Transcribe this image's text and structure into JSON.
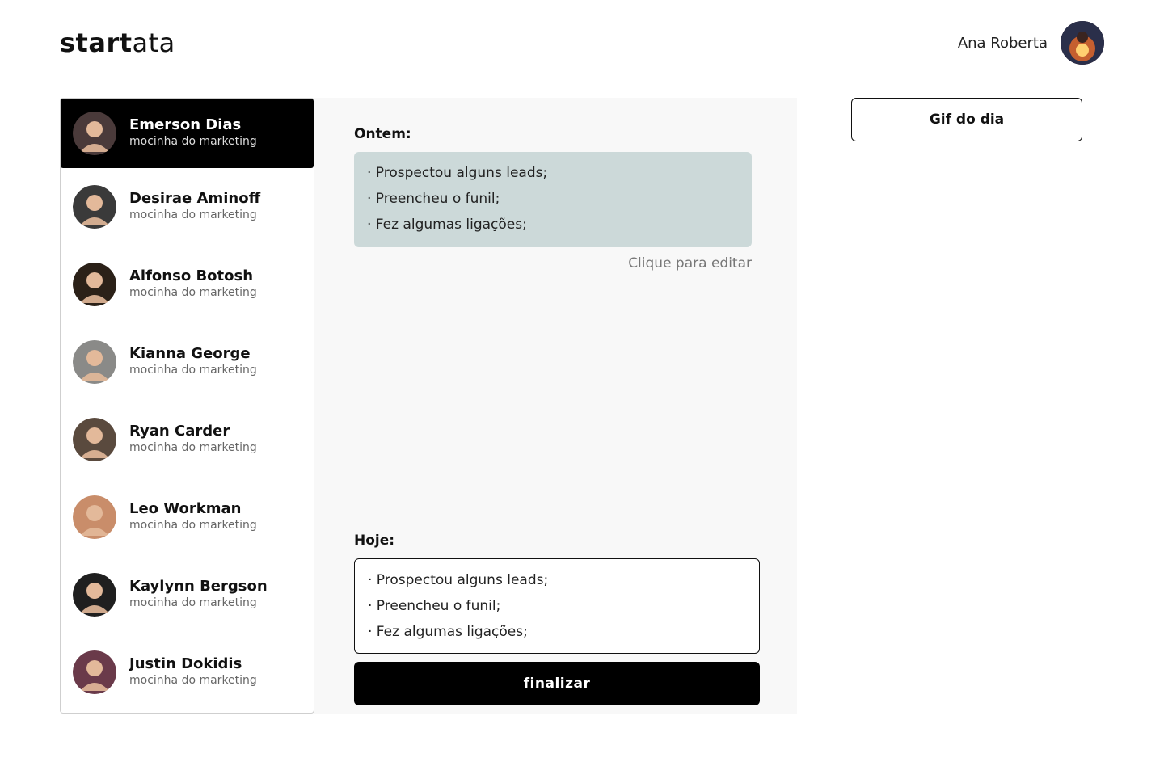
{
  "header": {
    "logo_bold": "start",
    "logo_light": "ata",
    "user_name": "Ana Roberta"
  },
  "sidebar": {
    "people": [
      {
        "name": "Emerson Dias",
        "role": "mocinha do marketing",
        "active": true,
        "avatar_color": "#4a3a3a"
      },
      {
        "name": "Desirae Aminoff",
        "role": "mocinha do marketing",
        "active": false,
        "avatar_color": "#3a3a3a"
      },
      {
        "name": "Alfonso Botosh",
        "role": "mocinha do marketing",
        "active": false,
        "avatar_color": "#2b2118"
      },
      {
        "name": "Kianna George",
        "role": "mocinha do marketing",
        "active": false,
        "avatar_color": "#8a8a88"
      },
      {
        "name": "Ryan Carder",
        "role": "mocinha do marketing",
        "active": false,
        "avatar_color": "#5a4a3e"
      },
      {
        "name": "Leo Workman",
        "role": "mocinha do marketing",
        "active": false,
        "avatar_color": "#c98d6a"
      },
      {
        "name": "Kaylynn Bergson",
        "role": "mocinha do marketing",
        "active": false,
        "avatar_color": "#1f1f1f"
      },
      {
        "name": "Justin Dokidis",
        "role": "mocinha do marketing",
        "active": false,
        "avatar_color": "#6a3a4a"
      }
    ]
  },
  "main": {
    "yesterday_title": "Ontem:",
    "yesterday_items": [
      "· Prospectou alguns leads;",
      "· Preencheu o funil;",
      "· Fez algumas ligações;"
    ],
    "edit_hint": "Clique para editar",
    "today_title": "Hoje:",
    "today_items": [
      "· Prospectou alguns leads;",
      "· Preencheu o funil;",
      "· Fez algumas ligações;"
    ],
    "finish_label": "finalizar"
  },
  "aside": {
    "gif_label": "Gif do dia"
  },
  "colors": {
    "active_bg": "#000000",
    "yesterday_bg": "#ccd9d9",
    "main_bg": "#f8f8f8"
  }
}
